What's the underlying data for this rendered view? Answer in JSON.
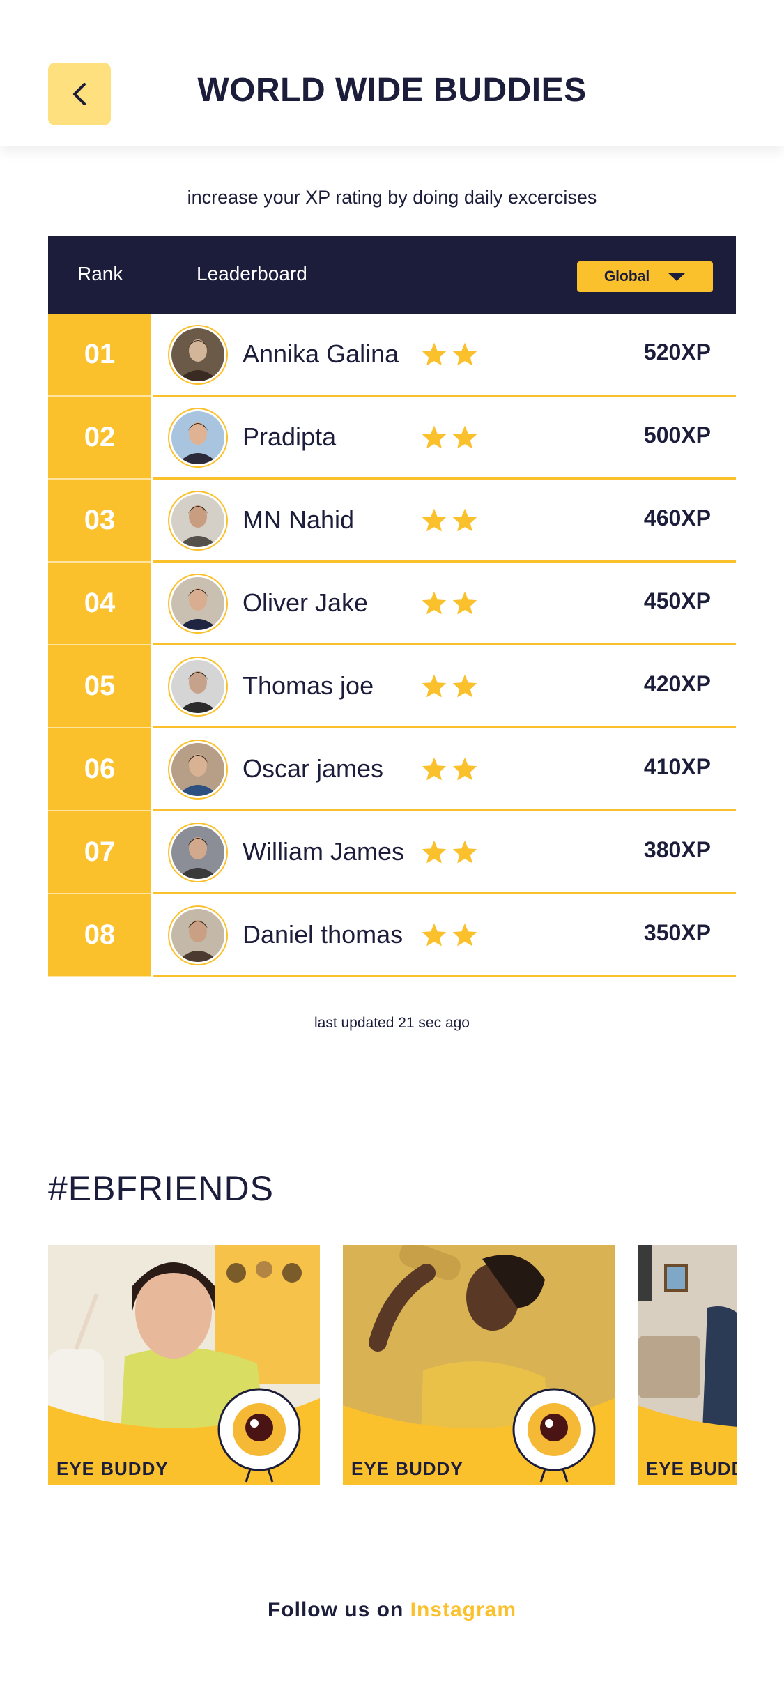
{
  "header": {
    "title": "WORLD WIDE BUDDIES",
    "back_icon": "chevron-left-icon"
  },
  "subtitle": "increase your XP rating by doing daily excercises",
  "leaderboard": {
    "col_rank": "Rank",
    "col_board": "Leaderboard",
    "scope_selected": "Global",
    "rows": [
      {
        "rank": "01",
        "name": "Annika Galina",
        "stars": 2,
        "xp": "520XP"
      },
      {
        "rank": "02",
        "name": "Pradipta",
        "stars": 2,
        "xp": "500XP"
      },
      {
        "rank": "03",
        "name": "MN Nahid",
        "stars": 2,
        "xp": "460XP"
      },
      {
        "rank": "04",
        "name": "Oliver Jake",
        "stars": 2,
        "xp": "450XP"
      },
      {
        "rank": "05",
        "name": "Thomas joe",
        "stars": 2,
        "xp": "420XP"
      },
      {
        "rank": "06",
        "name": "Oscar james",
        "stars": 2,
        "xp": "410XP"
      },
      {
        "rank": "07",
        "name": "William James",
        "stars": 2,
        "xp": "380XP"
      },
      {
        "rank": "08",
        "name": "Daniel thomas",
        "stars": 2,
        "xp": "350XP"
      }
    ]
  },
  "updated_text": "last updated 21 sec ago",
  "friends": {
    "title": "#EBFRIENDS",
    "cards": [
      {
        "label": "EYE BUDDY"
      },
      {
        "label": "EYE BUDDY"
      },
      {
        "label": "EYE BUDDY"
      }
    ]
  },
  "footer": {
    "follow_text": "Follow us on",
    "link_text": "Instagram"
  },
  "colors": {
    "navy": "#1b1d3a",
    "yellow": "#fbc12d",
    "light_yellow": "#ffe07f"
  }
}
